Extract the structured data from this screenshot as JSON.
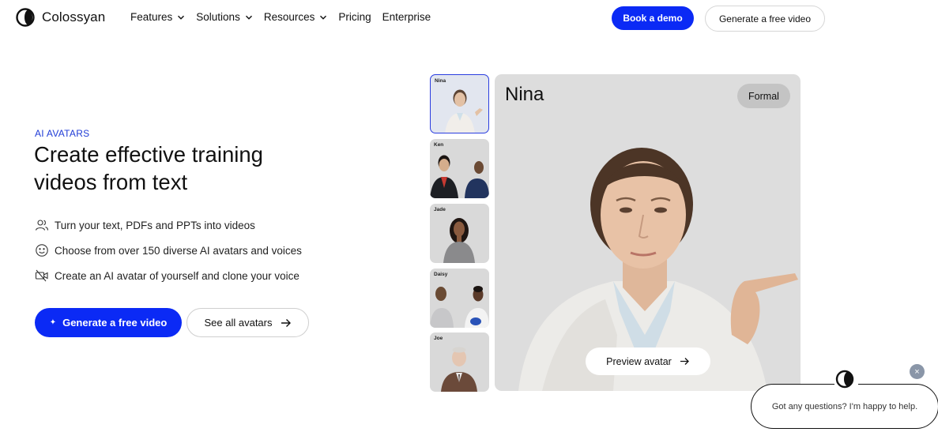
{
  "nav": {
    "brand": "Colossyan",
    "menu": [
      {
        "label": "Features",
        "dropdown": true
      },
      {
        "label": "Solutions",
        "dropdown": true
      },
      {
        "label": "Resources",
        "dropdown": true
      },
      {
        "label": "Pricing",
        "dropdown": false
      },
      {
        "label": "Enterprise",
        "dropdown": false
      }
    ],
    "demo_button": "Book a demo",
    "generate_button": "Generate a free video"
  },
  "hero": {
    "eyebrow": "AI AVATARS",
    "headline": "Create effective training videos from text",
    "features": [
      {
        "icon": "users-icon",
        "text": "Turn your text, PDFs and PPTs into videos"
      },
      {
        "icon": "smile-icon",
        "text": "Choose from over 150 diverse AI avatars and voices"
      },
      {
        "icon": "video-off-icon",
        "text": "Create an AI avatar of yourself and clone your voice"
      }
    ],
    "cta_primary": "Generate a free video",
    "cta_secondary": "See all avatars"
  },
  "avatars": {
    "list": [
      {
        "name": "Nina",
        "selected": true
      },
      {
        "name": "Ken",
        "selected": false
      },
      {
        "name": "Jade",
        "selected": false
      },
      {
        "name": "Daisy",
        "selected": false
      },
      {
        "name": "Joe",
        "selected": false
      }
    ],
    "current": {
      "name": "Nina",
      "style": "Formal",
      "preview_button": "Preview avatar"
    }
  },
  "chat": {
    "message": "Got any questions? I'm happy to help.",
    "close": "×"
  },
  "colors": {
    "accent": "#0b2af5",
    "eyebrow": "#1f3bd6",
    "preview_bg": "#dddddd",
    "badge_bg": "#c4c4c4"
  }
}
